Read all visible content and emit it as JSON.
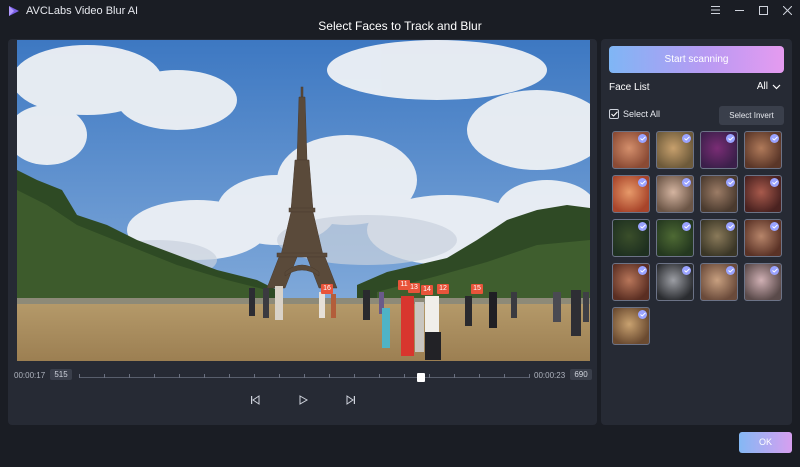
{
  "app": {
    "title": "AVCLabs Video Blur AI",
    "dialog_title": "Select Faces to Track and Blur",
    "logo_color": "#7d62e8"
  },
  "window_controls": [
    "menu-icon",
    "minimize-icon",
    "maximize-icon",
    "close-icon"
  ],
  "video": {
    "face_tags": [
      "16",
      "11",
      "13",
      "14",
      "12",
      "15"
    ]
  },
  "timeline": {
    "start_time": "00:00:17",
    "start_frame": "515",
    "end_time": "00:00:23",
    "end_frame": "690",
    "progress": 0.76
  },
  "playback": {
    "buttons": [
      "previous-frame-icon",
      "play-icon",
      "next-frame-icon"
    ]
  },
  "panel": {
    "scan_label": "Start scanning",
    "face_list_label": "Face List",
    "filter_value": "All",
    "select_all_label": "Select All",
    "select_invert_label": "Select Invert",
    "accent": "#9aa3ff"
  },
  "faces": [
    {
      "c1": "#8a4a34",
      "c2": "#d48f6c"
    },
    {
      "c1": "#6d5a3a",
      "c2": "#c7a06d"
    },
    {
      "c1": "#3b1f4a",
      "c2": "#7a2d75"
    },
    {
      "c1": "#5a3628",
      "c2": "#b07a5a"
    },
    {
      "c1": "#a8442a",
      "c2": "#e79a6a"
    },
    {
      "c1": "#6b5546",
      "c2": "#d4b4a0"
    },
    {
      "c1": "#4a3a2e",
      "c2": "#9c7c66"
    },
    {
      "c1": "#4a2220",
      "c2": "#a85a4c"
    },
    {
      "c1": "#1e3020",
      "c2": "#3a4e2a"
    },
    {
      "c1": "#24381f",
      "c2": "#4e6a34"
    },
    {
      "c1": "#3a3626",
      "c2": "#8a7a5a"
    },
    {
      "c1": "#5a3226",
      "c2": "#b7856a"
    },
    {
      "c1": "#5a2e22",
      "c2": "#b8765a"
    },
    {
      "c1": "#2a2c30",
      "c2": "#9c9ea4"
    },
    {
      "c1": "#6a4a3a",
      "c2": "#c8a080"
    },
    {
      "c1": "#5a4a4a",
      "c2": "#d0b0b4"
    },
    {
      "c1": "#6a4a30",
      "c2": "#c9a270"
    }
  ],
  "footer": {
    "ok_label": "OK"
  }
}
